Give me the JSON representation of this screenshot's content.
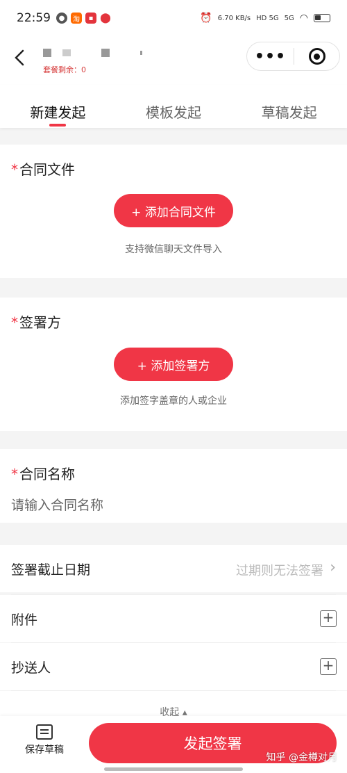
{
  "status_bar": {
    "time": "22:59",
    "speed": "6.70 KB/s",
    "network_a": "HD 5G",
    "network_b": "5G"
  },
  "nav": {
    "back_icon": "chevron-left-icon",
    "leftover_text": "套餐剩余：0"
  },
  "tabs": [
    {
      "label": "新建发起",
      "active": true
    },
    {
      "label": "模板发起",
      "active": false
    },
    {
      "label": "草稿发起",
      "active": false
    }
  ],
  "contract_file": {
    "required_mark": "*",
    "title": "合同文件",
    "button_label": "+ 添加合同文件",
    "hint": "支持微信聊天文件导入"
  },
  "signatory": {
    "required_mark": "*",
    "title": "签署方",
    "button_label": "+ 添加签署方",
    "hint": "添加签字盖章的人或企业"
  },
  "contract_name": {
    "required_mark": "*",
    "title": "合同名称",
    "placeholder": "请输入合同名称"
  },
  "options": {
    "deadline_label": "签署截止日期",
    "deadline_value": "过期则无法签署",
    "attachment_label": "附件",
    "cc_label": "抄送人",
    "collapse_label": "收起 ▴"
  },
  "footer": {
    "draft_label": "保存草稿",
    "submit_label": "发起签署",
    "watermark": "知乎 @金樽对月"
  },
  "colors": {
    "accent": "#f03646"
  }
}
